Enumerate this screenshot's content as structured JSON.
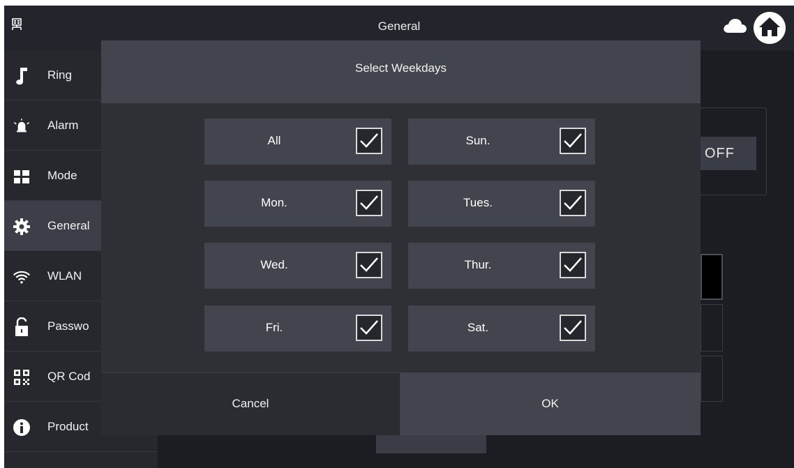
{
  "topbar": {
    "title": "General",
    "left_icon": "network-icon",
    "right_icons": [
      "cloud-icon",
      "home-icon"
    ]
  },
  "sidebar": {
    "items": [
      {
        "label": "Ring",
        "icon": "music-note-icon",
        "active": false
      },
      {
        "label": "Alarm",
        "icon": "siren-icon",
        "active": false
      },
      {
        "label": "Mode",
        "icon": "grid-icon",
        "active": false
      },
      {
        "label": "General",
        "icon": "gear-icon",
        "active": true
      },
      {
        "label": "WLAN",
        "icon": "wifi-icon",
        "active": false
      },
      {
        "label": "Passwo",
        "icon": "lock-icon",
        "active": false
      },
      {
        "label": "QR Cod",
        "icon": "qr-code-icon",
        "active": false
      },
      {
        "label": "Product",
        "icon": "info-icon",
        "active": false
      }
    ]
  },
  "background": {
    "toggle_label": "OFF"
  },
  "dialog": {
    "title": "Select Weekdays",
    "days": [
      {
        "label": "All",
        "checked": true
      },
      {
        "label": "Sun.",
        "checked": true
      },
      {
        "label": "Mon.",
        "checked": true
      },
      {
        "label": "Tues.",
        "checked": true
      },
      {
        "label": "Wed.",
        "checked": true
      },
      {
        "label": "Thur.",
        "checked": true
      },
      {
        "label": "Fri.",
        "checked": true
      },
      {
        "label": "Sat.",
        "checked": true
      }
    ],
    "cancel_label": "Cancel",
    "ok_label": "OK"
  },
  "colors": {
    "background": "#1b1d22",
    "panel": "#42454d",
    "dialog": "#2e3036",
    "text": "#ffffff"
  }
}
